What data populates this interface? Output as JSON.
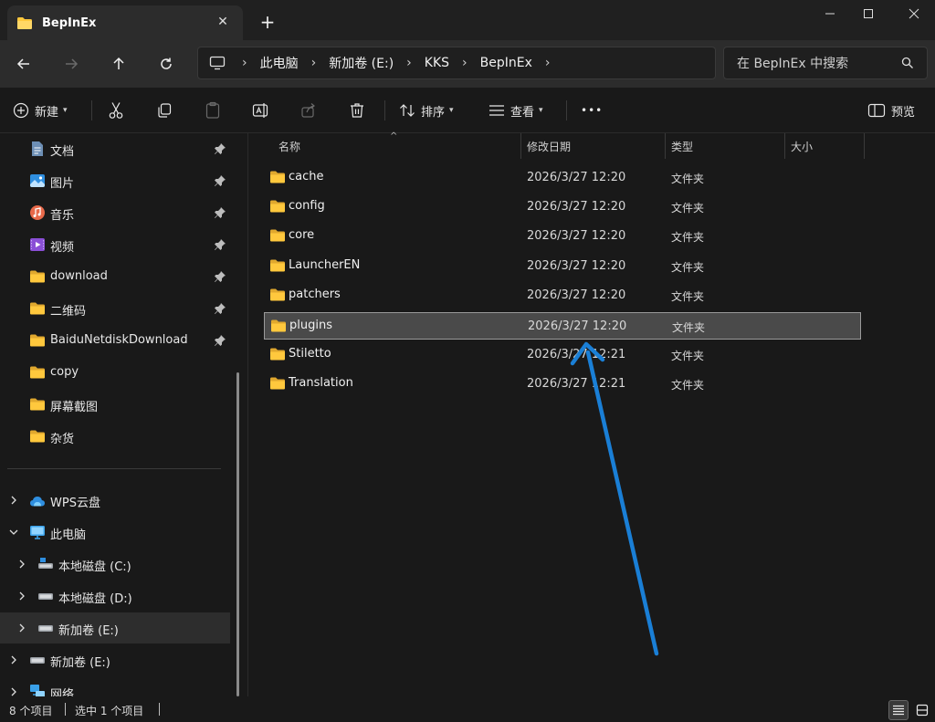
{
  "window": {
    "tab_title": "BepInEx",
    "tab_close_symbol": "✕",
    "new_tab_symbol": "+"
  },
  "address": {
    "breadcrumbs": [
      "此电脑",
      "新加卷 (E:)",
      "KKS",
      "BepInEx"
    ],
    "search_placeholder": "在 BepInEx 中搜索"
  },
  "toolbar": {
    "new_label": "新建",
    "sort_label": "排序",
    "view_label": "查看",
    "more_label": "•••",
    "preview_label": "预览"
  },
  "sidebar": {
    "quick_access": [
      {
        "label": "文档",
        "icon": "document-icon"
      },
      {
        "label": "图片",
        "icon": "pictures-icon"
      },
      {
        "label": "音乐",
        "icon": "music-icon"
      },
      {
        "label": "视频",
        "icon": "video-icon"
      },
      {
        "label": "download",
        "icon": "folder-icon"
      },
      {
        "label": "二维码",
        "icon": "folder-icon"
      },
      {
        "label": "BaiduNetdiskDownload",
        "icon": "folder-icon"
      },
      {
        "label": "copy",
        "icon": "folder-icon"
      },
      {
        "label": "屏幕截图",
        "icon": "folder-icon"
      },
      {
        "label": "杂货",
        "icon": "folder-icon"
      }
    ],
    "tree": [
      {
        "label": "WPS云盘",
        "icon": "cloud-icon"
      },
      {
        "label": "此电脑",
        "icon": "computer-icon"
      },
      {
        "label": "本地磁盘 (C:)",
        "icon": "drive-icon"
      },
      {
        "label": "本地磁盘 (D:)",
        "icon": "drive-icon"
      },
      {
        "label": "新加卷 (E:)",
        "icon": "drive-icon"
      },
      {
        "label": "新加卷 (E:)",
        "icon": "drive-icon"
      },
      {
        "label": "网络",
        "icon": "network-icon"
      }
    ]
  },
  "columns": {
    "name": "名称",
    "modified": "修改日期",
    "type": "类型",
    "size": "大小"
  },
  "files": [
    {
      "name": "cache",
      "date": "2026/3/27 12:20",
      "type": "文件夹"
    },
    {
      "name": "config",
      "date": "2026/3/27 12:20",
      "type": "文件夹"
    },
    {
      "name": "core",
      "date": "2026/3/27 12:20",
      "type": "文件夹"
    },
    {
      "name": "LauncherEN",
      "date": "2026/3/27 12:20",
      "type": "文件夹"
    },
    {
      "name": "patchers",
      "date": "2026/3/27 12:20",
      "type": "文件夹"
    },
    {
      "name": "plugins",
      "date": "2026/3/27 12:20",
      "type": "文件夹"
    },
    {
      "name": "Stiletto",
      "date": "2026/3/27 12:21",
      "type": "文件夹"
    },
    {
      "name": "Translation",
      "date": "2026/3/27 12:21",
      "type": "文件夹"
    }
  ],
  "status": {
    "item_count": "8 个项目",
    "selected": "选中 1 个项目"
  },
  "colors": {
    "accent": "#ffc83d",
    "annotation_arrow": "#1a7fd6"
  }
}
